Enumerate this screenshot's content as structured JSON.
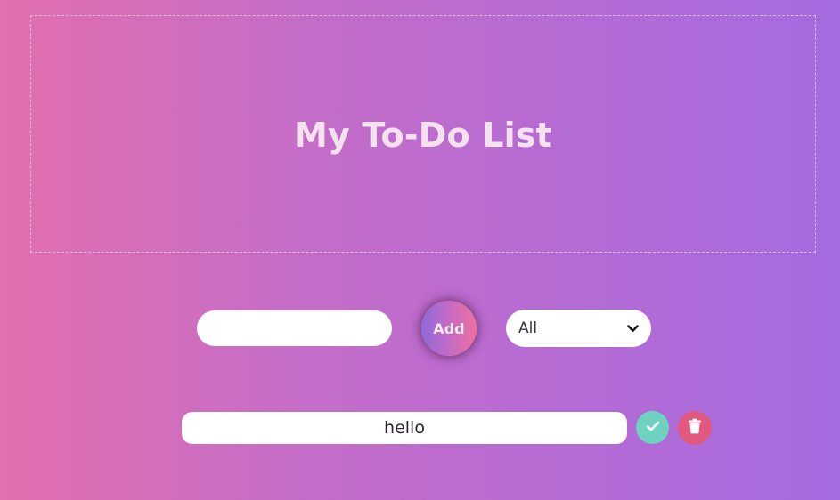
{
  "header": {
    "title": "My To-Do List"
  },
  "form": {
    "input_value": "",
    "input_placeholder": "",
    "add_label": "Add",
    "filter_selected": "All"
  },
  "todos": [
    {
      "text": "hello"
    }
  ],
  "icons": {
    "complete": "check-icon",
    "delete": "trash-icon",
    "select": "chevron-down-icon"
  },
  "colors": {
    "background_start": "#e26fae",
    "background_end": "#a66be0",
    "complete": "#6fd2be",
    "delete": "#e1597f"
  }
}
